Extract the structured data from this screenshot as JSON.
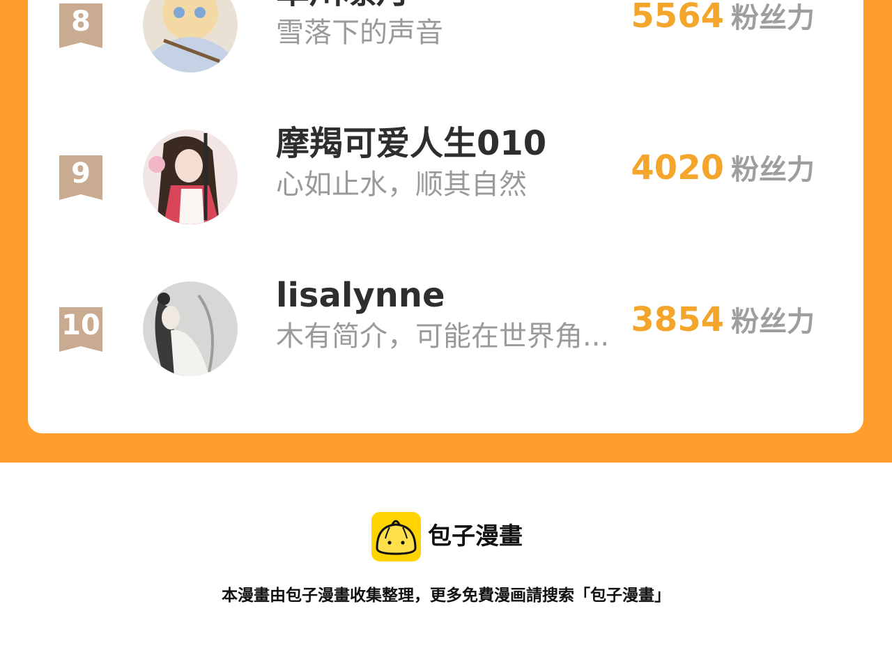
{
  "leaderboard": {
    "entries": [
      {
        "rank": "8",
        "name": "草川凛月",
        "bio": "雪落下的声音",
        "fans": "5564",
        "fans_label": "粉丝力"
      },
      {
        "rank": "9",
        "name": "摩羯可爱人生010",
        "bio": "心如止水，顺其自然",
        "fans": "4020",
        "fans_label": "粉丝力"
      },
      {
        "rank": "10",
        "name": "lisalynne",
        "bio": "木有简介，可能在世界角...",
        "fans": "3854",
        "fans_label": "粉丝力"
      }
    ]
  },
  "footer": {
    "brand": "包子漫畫",
    "note": "本漫畫由包子漫畫收集整理，更多免費漫画請搜索「包子漫畫」"
  },
  "colors": {
    "band": "#ff9e2c",
    "fans_count": "#f4a52b",
    "rank_badge": "#c9ab92",
    "logo_bg": "#ffd400"
  }
}
